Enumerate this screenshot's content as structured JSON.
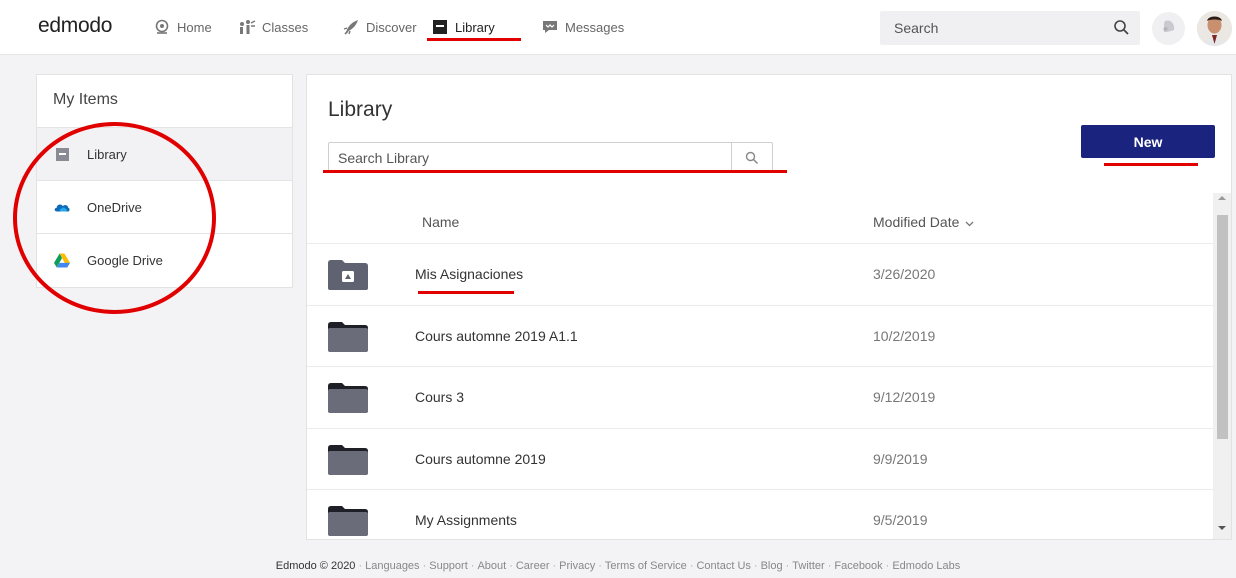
{
  "brand": {
    "logo": "edmodo"
  },
  "nav": {
    "items": [
      {
        "id": "home",
        "label": "Home",
        "icon": "home-icon"
      },
      {
        "id": "classes",
        "label": "Classes",
        "icon": "classes-icon"
      },
      {
        "id": "discover",
        "label": "Discover",
        "icon": "rocket-icon"
      },
      {
        "id": "library",
        "label": "Library",
        "icon": "library-icon",
        "active": true
      },
      {
        "id": "messages",
        "label": "Messages",
        "icon": "message-icon"
      }
    ],
    "search_placeholder": "Search"
  },
  "sidebar": {
    "title": "My Items",
    "items": [
      {
        "label": "Library",
        "icon": "library-icon",
        "selected": true
      },
      {
        "label": "OneDrive",
        "icon": "onedrive-icon"
      },
      {
        "label": "Google Drive",
        "icon": "google-drive-icon"
      }
    ]
  },
  "main": {
    "title": "Library",
    "search_placeholder": "Search Library",
    "new_button": "New",
    "columns": {
      "name": "Name",
      "modified": "Modified Date"
    },
    "rows": [
      {
        "name": "Mis Asignaciones",
        "date": "3/26/2020",
        "special": true
      },
      {
        "name": "Cours automne 2019 A1.1",
        "date": "10/2/2019"
      },
      {
        "name": "Cours 3",
        "date": "9/12/2019"
      },
      {
        "name": "Cours automne 2019",
        "date": "9/9/2019"
      },
      {
        "name": "My Assignments",
        "date": "9/5/2019"
      }
    ]
  },
  "footer": {
    "copyright": "Edmodo © 2020",
    "links": [
      "Languages",
      "Support",
      "About",
      "Career",
      "Privacy",
      "Terms of Service",
      "Contact Us",
      "Blog",
      "Twitter",
      "Facebook",
      "Edmodo Labs"
    ]
  },
  "colors": {
    "accent": "#1a237e",
    "annotation_red": "#e00000",
    "folder": "#5f6270"
  }
}
